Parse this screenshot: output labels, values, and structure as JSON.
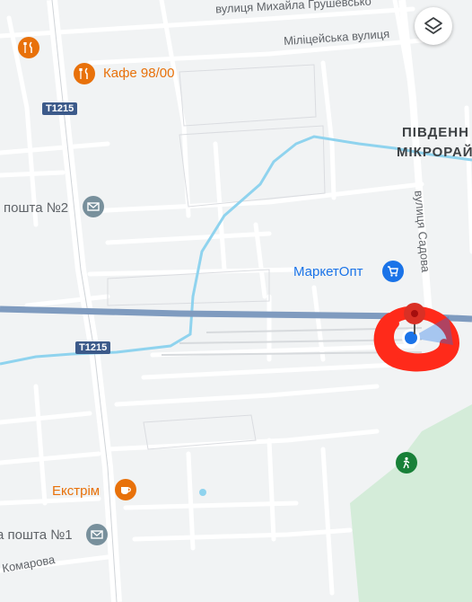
{
  "streets": {
    "hrushevskoho": "вулиця Михайла Грушевсько",
    "militseiska": "Міліцейська вулиця",
    "sadova": "вулиця Садова",
    "komarova": "Комарова",
    "pivdennyi": "ПІВДЕНН",
    "mikroraion": "МІКРОРАЙ"
  },
  "highways": {
    "t1215_top": "T1215",
    "t1215_mid": "T1215"
  },
  "pois": {
    "cafe": "Кафе 98/00",
    "post2": "пошта №2",
    "marketopt": "МаркетОпт",
    "ekstrim": "Екстрім",
    "post1": "а пошта №1"
  },
  "icons": {
    "restaurant": "fork-knife-icon",
    "mail": "envelope-icon",
    "shop": "cart-icon",
    "cafe": "coffee-cup-icon",
    "park": "hiker-icon",
    "layers": "layers-icon"
  },
  "colors": {
    "background": "#f1f3f4",
    "road": "#ffffff",
    "highway": "#7f9bbf",
    "river": "#8fd3ee",
    "park": "#d4ecd9",
    "poi_orange": "#e8710a",
    "poi_blue": "#1a73e8",
    "marker_red": "#d93025",
    "annotation_red": "#ff2a1a"
  }
}
